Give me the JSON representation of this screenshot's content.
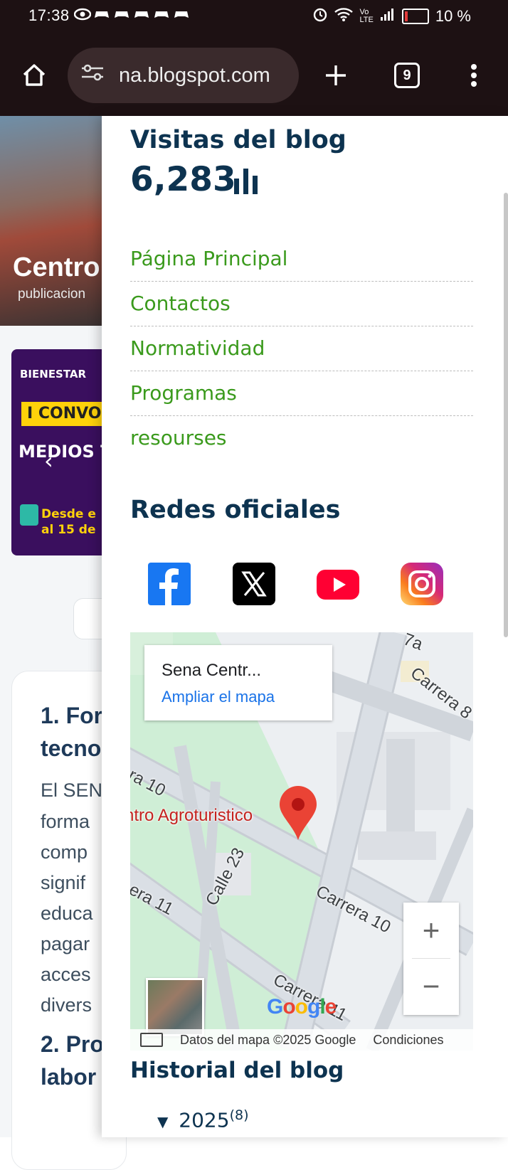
{
  "status_bar": {
    "time": "17:38",
    "battery": "10 %"
  },
  "browser": {
    "url": "na.blogspot.com",
    "tab_count": "9"
  },
  "background_page": {
    "hero_title": "Centro",
    "hero_subtitle": "publicacion",
    "banner_brand": "BIENESTAR",
    "banner_convo": "I CONVO",
    "banner_medios": "MEDIOS T",
    "banner_date_1": "Desde e",
    "banner_date_2": "al 15 de",
    "article_heading_1": "1. For",
    "article_heading_1b": "tecno",
    "article_lines": [
      "El SEN",
      "forma",
      "comp",
      "signif",
      "educa",
      "pagar",
      "acces",
      "divers"
    ],
    "article_heading_2": "2. Pro",
    "article_heading_2b": "labor"
  },
  "sidebar": {
    "stats_title": "Visitas del blog",
    "stats_count": "6,283",
    "links": [
      {
        "label": "Página Principal"
      },
      {
        "label": "Contactos"
      },
      {
        "label": "Normatividad"
      },
      {
        "label": "Programas"
      },
      {
        "label": "resourses"
      }
    ],
    "social_title": "Redes oficiales",
    "social": [
      {
        "name": "facebook",
        "color": "#1877f2"
      },
      {
        "name": "x",
        "color": "#000000"
      },
      {
        "name": "youtube",
        "color": "#ff0033"
      },
      {
        "name": "instagram",
        "color": "#e1306c"
      }
    ],
    "map": {
      "place_name": "Sena Centr...",
      "expand_link": "Ampliar el mapa",
      "pin_label": "ntro Agroturistico",
      "roads": [
        "Carrera 8",
        "ra 10",
        "Calle 23",
        "Carrera 10",
        "era 11",
        "Carrera 11",
        "7a"
      ],
      "google_logo": "Google",
      "attribution": "Datos del mapa ©2025 Google",
      "terms": "Condiciones",
      "zoom_in": "+",
      "zoom_out": "−"
    },
    "history_title": "Historial del blog",
    "history_year": "2025",
    "history_count": "(8)"
  },
  "colors": {
    "heading": "#0d3350",
    "link": "#3a9a1c",
    "chrome": "#1d1113"
  }
}
